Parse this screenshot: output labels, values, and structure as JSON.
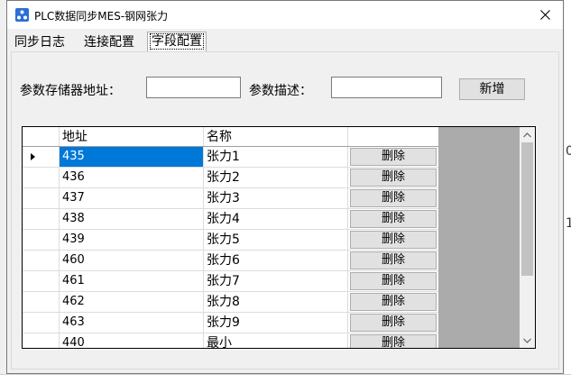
{
  "window": {
    "title": "PLC数据同步MES-钢网张力"
  },
  "tabs": [
    {
      "label": "同步日志",
      "active": false
    },
    {
      "label": "连接配置",
      "active": false
    },
    {
      "label": "字段配置",
      "active": true
    }
  ],
  "form": {
    "address_label": "参数存储器地址：",
    "address_value": "",
    "desc_label": "参数描述：",
    "desc_value": "",
    "add_button": "新增"
  },
  "grid": {
    "columns": [
      "",
      "地址",
      "名称",
      ""
    ],
    "rows": [
      {
        "address": "435",
        "name": "张力1",
        "action": "删除",
        "selected": true
      },
      {
        "address": "436",
        "name": "张力2",
        "action": "删除"
      },
      {
        "address": "437",
        "name": "张力3",
        "action": "删除"
      },
      {
        "address": "438",
        "name": "张力4",
        "action": "删除"
      },
      {
        "address": "439",
        "name": "张力5",
        "action": "删除"
      },
      {
        "address": "460",
        "name": "张力6",
        "action": "删除"
      },
      {
        "address": "461",
        "name": "张力7",
        "action": "删除"
      },
      {
        "address": "462",
        "name": "张力8",
        "action": "删除"
      },
      {
        "address": "463",
        "name": "张力9",
        "action": "删除"
      },
      {
        "address": "440",
        "name": "最小",
        "action": "删除"
      }
    ]
  },
  "background": {
    "frag1": "0",
    "frag2": "1"
  },
  "colors": {
    "selection": "#0078d7",
    "grid_background": "#ababab",
    "icon_blue": "#2b6fd6"
  }
}
